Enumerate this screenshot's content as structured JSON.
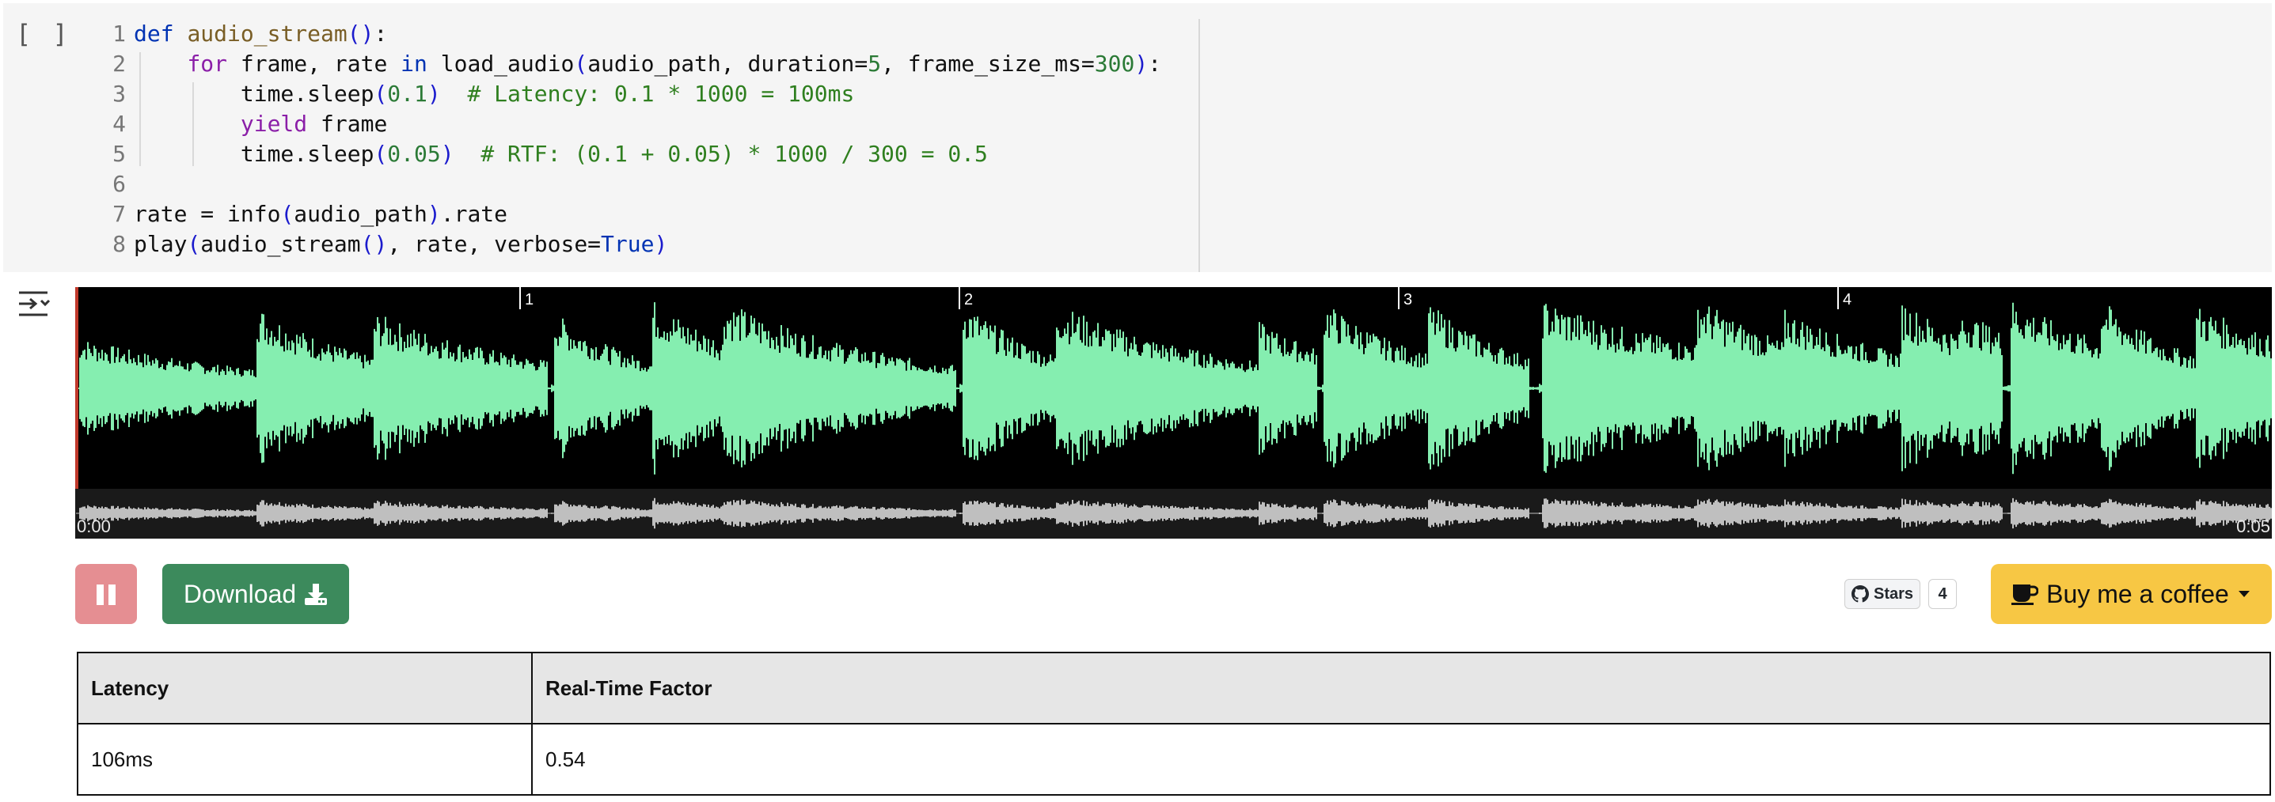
{
  "cell": {
    "run_indicator": "[ ]",
    "code_lines": [
      {
        "n": "1",
        "tokens": [
          [
            "kw",
            "def"
          ],
          [
            "tx",
            " "
          ],
          [
            "fn",
            "audio_stream"
          ],
          [
            "br",
            "()"
          ],
          [
            "tx",
            ":"
          ]
        ]
      },
      {
        "n": "2",
        "tokens": [
          [
            "tx",
            "    "
          ],
          [
            "kw2",
            "for"
          ],
          [
            "tx",
            " frame, rate "
          ],
          [
            "kw",
            "in"
          ],
          [
            "tx",
            " load_audio"
          ],
          [
            "br",
            "("
          ],
          [
            "tx",
            "audio_path, duration="
          ],
          [
            "num",
            "5"
          ],
          [
            "tx",
            ", frame_size_ms="
          ],
          [
            "num",
            "300"
          ],
          [
            "br",
            ")"
          ],
          [
            "tx",
            ":"
          ]
        ]
      },
      {
        "n": "3",
        "tokens": [
          [
            "tx",
            "        time.sleep"
          ],
          [
            "br",
            "("
          ],
          [
            "num",
            "0.1"
          ],
          [
            "br",
            ")"
          ],
          [
            "tx",
            "  "
          ],
          [
            "com",
            "# Latency: 0.1 * 1000 = 100ms"
          ]
        ]
      },
      {
        "n": "4",
        "tokens": [
          [
            "tx",
            "        "
          ],
          [
            "kw2",
            "yield"
          ],
          [
            "tx",
            " frame"
          ]
        ]
      },
      {
        "n": "5",
        "tokens": [
          [
            "tx",
            "        time.sleep"
          ],
          [
            "br",
            "("
          ],
          [
            "num",
            "0.05"
          ],
          [
            "br",
            ")"
          ],
          [
            "tx",
            "  "
          ],
          [
            "com",
            "# RTF: (0.1 + 0.05) * 1000 / 300 = 0.5"
          ]
        ]
      },
      {
        "n": "6",
        "tokens": []
      },
      {
        "n": "7",
        "tokens": [
          [
            "tx",
            "rate = info"
          ],
          [
            "br",
            "("
          ],
          [
            "tx",
            "audio_path"
          ],
          [
            "br",
            ")"
          ],
          [
            "tx",
            ".rate"
          ]
        ]
      },
      {
        "n": "8",
        "tokens": [
          [
            "tx",
            "play"
          ],
          [
            "br",
            "("
          ],
          [
            "tx",
            "audio_stream"
          ],
          [
            "br",
            "()"
          ],
          [
            "tx",
            ", rate, verbose="
          ],
          [
            "kw",
            "True"
          ],
          [
            "br",
            ")"
          ]
        ]
      }
    ]
  },
  "output": {
    "icon": "output-toggle-icon"
  },
  "player": {
    "ticks": [
      "1",
      "2",
      "3",
      "4"
    ],
    "time_start": "0:00",
    "time_end": "0:05",
    "duration_seconds": 5,
    "playhead_seconds": 0,
    "wave_color": "#85eeb0",
    "minimap_color": "#bfbfbf",
    "cursor_color": "#c0392b"
  },
  "controls": {
    "pause_icon": "pause-icon",
    "download_label": "Download",
    "download_icon": "download-icon",
    "github_label": "Stars",
    "github_icon": "github-icon",
    "github_count": "4",
    "coffee_label": "Buy me a coffee",
    "coffee_icon": "coffee-icon"
  },
  "table": {
    "headers": [
      "Latency",
      "Real-Time Factor"
    ],
    "rows": [
      [
        "106ms",
        "0.54"
      ]
    ]
  }
}
